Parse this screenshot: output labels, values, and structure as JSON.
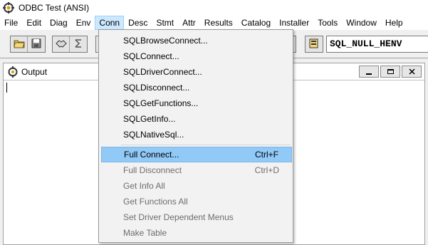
{
  "window": {
    "title": "ODBC Test (ANSI)"
  },
  "menubar": {
    "items": [
      "File",
      "Edit",
      "Diag",
      "Env",
      "Conn",
      "Desc",
      "Stmt",
      "Attr",
      "Results",
      "Catalog",
      "Installer",
      "Tools",
      "Window",
      "Help"
    ],
    "active": "Conn"
  },
  "toolbar": {
    "handle_field_value": "SQL_NULL_HENV"
  },
  "output": {
    "title": "Output"
  },
  "conn_menu": {
    "group1": [
      {
        "label": "SQLBrowseConnect..."
      },
      {
        "label": "SQLConnect..."
      },
      {
        "label": "SQLDriverConnect..."
      },
      {
        "label": "SQLDisconnect..."
      },
      {
        "label": "SQLGetFunctions..."
      },
      {
        "label": "SQLGetInfo..."
      },
      {
        "label": "SQLNativeSql..."
      }
    ],
    "group2": [
      {
        "label": "Full Connect...",
        "shortcut": "Ctrl+F",
        "state": "highlighted"
      },
      {
        "label": "Full Disconnect",
        "shortcut": "Ctrl+D",
        "state": "disabled"
      },
      {
        "label": "Get Info All",
        "state": "disabled"
      },
      {
        "label": "Get Functions All",
        "state": "disabled"
      },
      {
        "label": "Set Driver Dependent Menus",
        "state": "disabled"
      },
      {
        "label": "Make Table",
        "state": "disabled"
      }
    ]
  },
  "colors": {
    "menu_highlight": "#91c9f7",
    "menubar_active": "#cce8ff",
    "disabled_text": "#6d6d6d"
  }
}
